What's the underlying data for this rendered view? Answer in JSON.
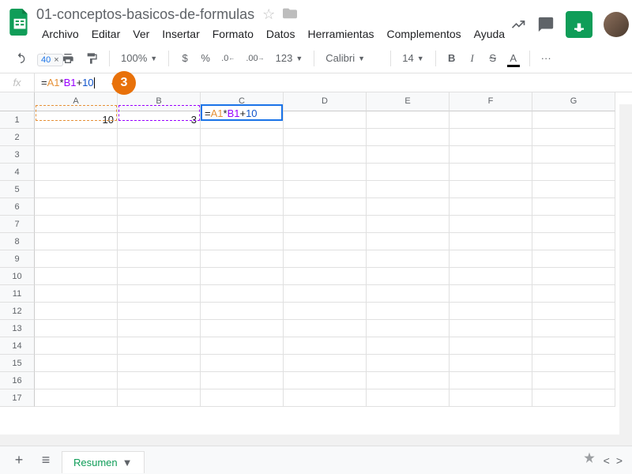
{
  "doc": {
    "title": "01-conceptos-basicos-de-formulas"
  },
  "menu": {
    "file": "Archivo",
    "edit": "Editar",
    "view": "Ver",
    "insert": "Insertar",
    "format": "Formato",
    "data": "Datos",
    "tools": "Herramientas",
    "addons": "Complementos",
    "help": "Ayuda"
  },
  "toolbar": {
    "zoom": "100%",
    "currency": "$",
    "percent": "%",
    "dec_dec": ".0",
    "inc_dec": ".00",
    "num_format": "123",
    "font": "Calibri",
    "font_size": "14",
    "bold": "B",
    "italic": "I",
    "strike": "S",
    "text_color": "A",
    "more": "···"
  },
  "formula": {
    "preview_value": "40",
    "preview_close": "×",
    "eq": "=",
    "refA": "A1",
    "op1": "*",
    "refB": "B1",
    "op2": "+",
    "num": "10"
  },
  "step_badge": "3",
  "columns": [
    "A",
    "B",
    "C",
    "D",
    "E",
    "F",
    "G"
  ],
  "row_count": 17,
  "cells": {
    "A1": "10",
    "B1": "3"
  },
  "active_cell_display": {
    "eq": "=",
    "refA": "A1",
    "op1": "*",
    "refB": "B1",
    "op2": "+",
    "num": "10"
  },
  "sheet": {
    "active_name": "Resumen"
  }
}
